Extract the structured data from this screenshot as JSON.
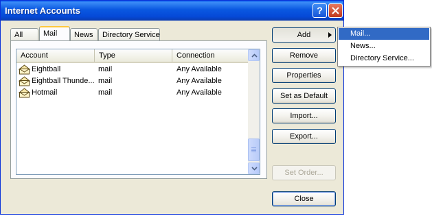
{
  "window": {
    "title": "Internet Accounts"
  },
  "tabs": [
    {
      "label": "All"
    },
    {
      "label": "Mail",
      "active": true
    },
    {
      "label": "News"
    },
    {
      "label": "Directory Service"
    }
  ],
  "list": {
    "columns": [
      "Account",
      "Type",
      "Connection"
    ],
    "rows": [
      {
        "account": "Eightball",
        "type": "mail",
        "connection": "Any Available"
      },
      {
        "account": "Eightball Thunde...",
        "type": "mail",
        "connection": "Any Available"
      },
      {
        "account": "Hotmail",
        "type": "mail",
        "connection": "Any Available"
      }
    ]
  },
  "buttons": {
    "add": "Add",
    "remove": "Remove",
    "properties": "Properties",
    "set_default": "Set as Default",
    "import": "Import...",
    "export": "Export...",
    "set_order": "Set Order...",
    "close": "Close"
  },
  "add_menu": [
    "Mail...",
    "News...",
    "Directory Service..."
  ],
  "colors": {
    "titlebar": "#0a58e1",
    "menu_highlight": "#316ac5",
    "dialog_bg": "#ece9d8"
  }
}
